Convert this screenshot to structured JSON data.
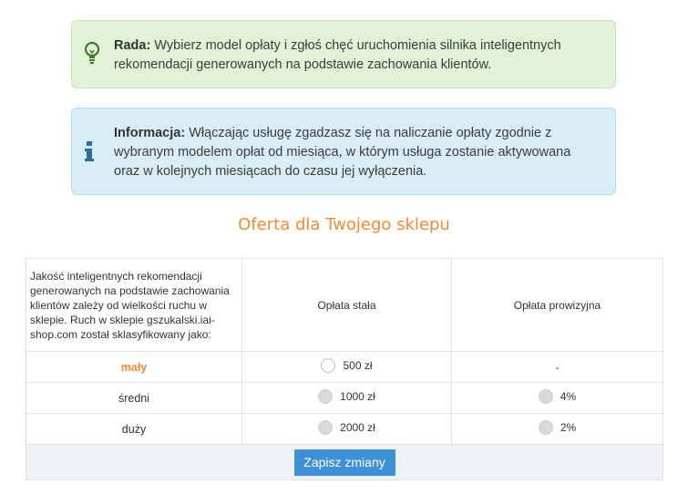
{
  "tip": {
    "label": "Rada:",
    "text": " Wybierz model opłaty i zgłoś chęć uruchomienia silnika inteligentnych rekomendacji generowanych na podstawie zachowania klientów."
  },
  "info": {
    "label": "Informacja:",
    "text": " Włączając usługę zgadzasz się na naliczanie opłaty zgodnie z wybranym modelem opłat od miesiąca, w którym usługa zostanie aktywowana oraz w kolejnych miesiącach do czasu jej wyłączenia."
  },
  "offer": {
    "title": "Oferta dla Twojego sklepu",
    "description": "Jakość inteligentnych rekomendacji generowanych na podstawie zachowania klientów zależy od wielkości ruchu w sklepie. Ruch w sklepie gszukalski.iai-shop.com został sklasyfikowany jako:",
    "col_fixed": "Opłata stała",
    "col_commission": "Opłata prowizyjna",
    "rows": [
      {
        "level": "mały",
        "fixed": "500 zł",
        "commission": "-"
      },
      {
        "level": "średni",
        "fixed": "1000 zł",
        "commission": "4%"
      },
      {
        "level": "duży",
        "fixed": "2000 zł",
        "commission": "2%"
      }
    ],
    "save_label": "Zapisz zmiany"
  },
  "colors": {
    "accent": "#f5892f",
    "button": "#3d8fd6",
    "tip_bg": "#e2f2d7",
    "info_bg": "#d9edf7"
  }
}
